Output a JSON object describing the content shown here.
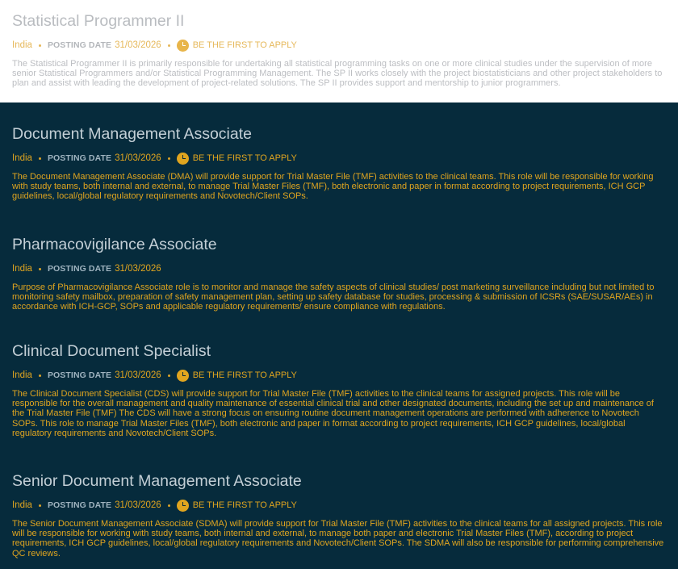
{
  "jobs": [
    {
      "title": "Statistical Programmer II",
      "country": "India",
      "posting_label": "POSTING DATE",
      "posting_date": "31/03/2026",
      "apply_label": "BE THE FIRST TO APPLY",
      "description": "The Statistical Programmer II is primarily responsible for undertaking all statistical programming tasks on one or more clinical studies under the supervision of more senior Statistical Programmers and/or Statistical Programming Management. The SP II works closely with the project biostatisticians and other project stakeholders to plan and assist with leading the development of project-related solutions. The SP II provides support and mentorship to junior programmers."
    },
    {
      "title": "Document Management Associate",
      "country": "India",
      "posting_label": "POSTING DATE",
      "posting_date": "31/03/2026",
      "apply_label": "BE THE FIRST TO APPLY",
      "description": "The Document Management Associate (DMA) will provide support for Trial Master File (TMF) activities to the clinical teams. This role will be responsible for working with study teams, both internal and external, to manage Trial Master Files (TMF), both electronic and paper in format according to project requirements, ICH GCP guidelines, local/global regulatory requirements and Novotech/Client SOPs."
    },
    {
      "title": "Pharmacovigilance Associate",
      "country": "India",
      "posting_label": "POSTING DATE",
      "posting_date": "31/03/2026",
      "description": "Purpose of Pharmacovigilance Associate role is to monitor and manage the safety aspects of clinical studies/ post marketing surveillance including but not limited to monitoring safety mailbox, preparation of safety management plan, setting up safety database for studies, processing & submission of ICSRs (SAE/SUSAR/AEs) in accordance with ICH-GCP, SOPs and applicable regulatory requirements/ ensure compliance with regulations."
    },
    {
      "title": "Clinical Document Specialist",
      "country": "India",
      "posting_label": "POSTING DATE",
      "posting_date": "31/03/2026",
      "apply_label": "BE THE FIRST TO APPLY",
      "description": "The Clinical Document Specialist (CDS) will provide support for Trial Master File (TMF) activities to the clinical teams for assigned projects. This role will be responsible for the overall management and quality maintenance of essential clinical trial and other designated documents, including the set up and maintenance of the Trial Master File (TMF) The CDS will have a strong focus on ensuring routine document management operations are performed with adherence to Novotech SOPs. This role to manage Trial Master Files (TMF), both electronic and paper in format according to project requirements, ICH GCP guidelines, local/global regulatory requirements and Novotech/Client SOPs."
    },
    {
      "title": "Senior Document Management Associate",
      "country": "India",
      "posting_label": "POSTING DATE",
      "posting_date": "31/03/2026",
      "apply_label": "BE THE FIRST TO APPLY",
      "description": "The Senior Document Management Associate (SDMA) will provide support for Trial Master File (TMF) activities to the clinical teams for all assigned projects. This role will be responsible for working with study teams, both internal and external, to manage both paper and electronic Trial Master Files (TMF), according to project requirements, ICH GCP guidelines, local/global regulatory requirements and Novotech/Client SOPs. The SDMA will also be responsible for performing comprehensive QC reviews."
    }
  ],
  "colors": {
    "dark_background": "#062b3c",
    "accent": "#e0a51f"
  },
  "icons": {
    "apply": "clock-icon"
  }
}
